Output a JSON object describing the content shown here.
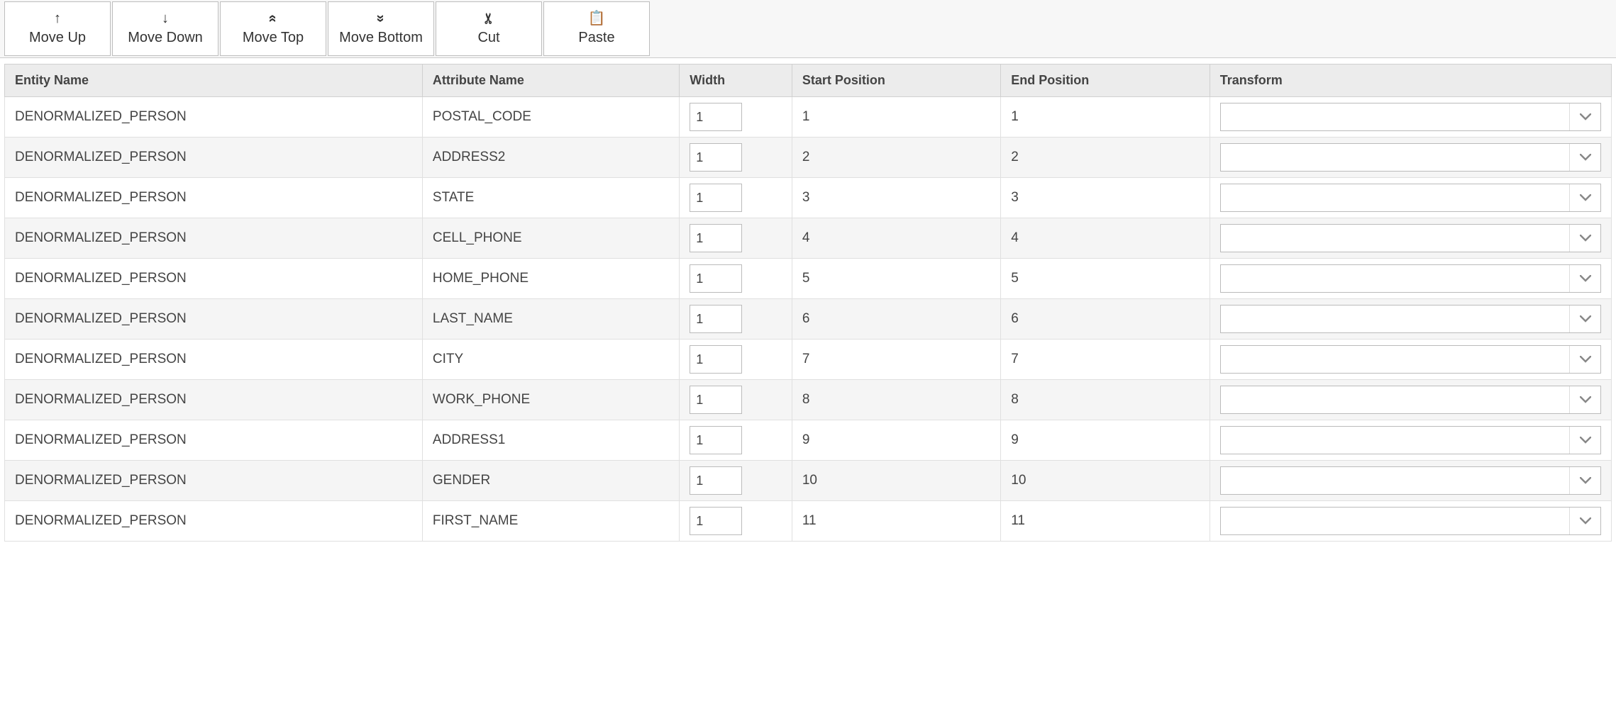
{
  "toolbar": {
    "moveUp": {
      "label": "Move Up",
      "icon": "↑"
    },
    "moveDown": {
      "label": "Move Down",
      "icon": "↓"
    },
    "moveTop": {
      "label": "Move Top",
      "icon": "«"
    },
    "moveBottom": {
      "label": "Move Bottom",
      "icon": "»"
    },
    "cut": {
      "label": "Cut",
      "icon": "✂"
    },
    "paste": {
      "label": "Paste",
      "icon": "📋"
    }
  },
  "columns": {
    "entity": "Entity Name",
    "attribute": "Attribute Name",
    "width": "Width",
    "start": "Start Position",
    "end": "End Position",
    "transform": "Transform"
  },
  "rows": [
    {
      "entity": "DENORMALIZED_PERSON",
      "attribute": "POSTAL_CODE",
      "width": "1",
      "start": "1",
      "end": "1",
      "transform": ""
    },
    {
      "entity": "DENORMALIZED_PERSON",
      "attribute": "ADDRESS2",
      "width": "1",
      "start": "2",
      "end": "2",
      "transform": ""
    },
    {
      "entity": "DENORMALIZED_PERSON",
      "attribute": "STATE",
      "width": "1",
      "start": "3",
      "end": "3",
      "transform": ""
    },
    {
      "entity": "DENORMALIZED_PERSON",
      "attribute": "CELL_PHONE",
      "width": "1",
      "start": "4",
      "end": "4",
      "transform": ""
    },
    {
      "entity": "DENORMALIZED_PERSON",
      "attribute": "HOME_PHONE",
      "width": "1",
      "start": "5",
      "end": "5",
      "transform": ""
    },
    {
      "entity": "DENORMALIZED_PERSON",
      "attribute": "LAST_NAME",
      "width": "1",
      "start": "6",
      "end": "6",
      "transform": ""
    },
    {
      "entity": "DENORMALIZED_PERSON",
      "attribute": "CITY",
      "width": "1",
      "start": "7",
      "end": "7",
      "transform": ""
    },
    {
      "entity": "DENORMALIZED_PERSON",
      "attribute": "WORK_PHONE",
      "width": "1",
      "start": "8",
      "end": "8",
      "transform": ""
    },
    {
      "entity": "DENORMALIZED_PERSON",
      "attribute": "ADDRESS1",
      "width": "1",
      "start": "9",
      "end": "9",
      "transform": ""
    },
    {
      "entity": "DENORMALIZED_PERSON",
      "attribute": "GENDER",
      "width": "1",
      "start": "10",
      "end": "10",
      "transform": ""
    },
    {
      "entity": "DENORMALIZED_PERSON",
      "attribute": "FIRST_NAME",
      "width": "1",
      "start": "11",
      "end": "11",
      "transform": ""
    }
  ]
}
